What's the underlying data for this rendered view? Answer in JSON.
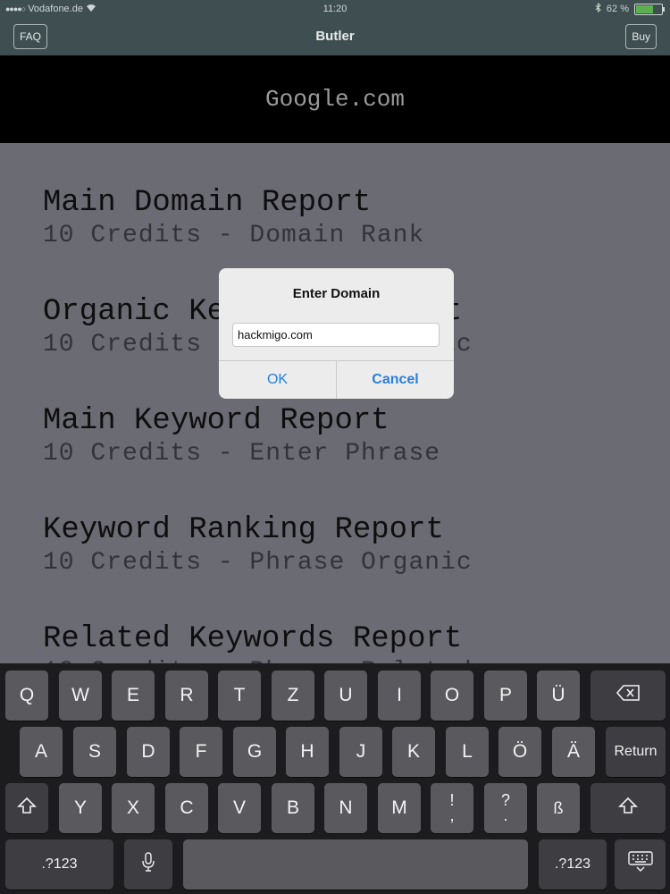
{
  "status_bar": {
    "carrier": "Vodafone.de",
    "time": "11:20",
    "battery_text": "62 %",
    "battery_level": 0.62,
    "battery_color": "#5bb04f"
  },
  "nav": {
    "title": "Butler",
    "left_button": "FAQ",
    "right_button": "Buy"
  },
  "banner": {
    "domain": "Google.com"
  },
  "reports": [
    {
      "name": "Main Domain Report",
      "detail": "10 Credits - Domain Rank"
    },
    {
      "name": "Organic Keywords Report",
      "detail": "10 Credits - Domain Organic"
    },
    {
      "name": "Main Keyword Report",
      "detail": "10 Credits - Enter Phrase"
    },
    {
      "name": "Keyword Ranking Report",
      "detail": "10 Credits - Phrase Organic"
    },
    {
      "name": "Related Keywords Report",
      "detail": "10 Credits - Phrase Related"
    }
  ],
  "alert": {
    "title": "Enter Domain",
    "input_value": "hackmigo.com",
    "ok_label": "OK",
    "cancel_label": "Cancel",
    "accent_color": "#2b7fd6"
  },
  "keyboard": {
    "row1": [
      "Q",
      "W",
      "E",
      "R",
      "T",
      "Z",
      "U",
      "I",
      "O",
      "P",
      "Ü"
    ],
    "row2": [
      "A",
      "S",
      "D",
      "F",
      "G",
      "H",
      "J",
      "K",
      "L",
      "Ö",
      "Ä"
    ],
    "row3": [
      "Y",
      "X",
      "C",
      "V",
      "B",
      "N",
      "M"
    ],
    "exclaim_top": "!",
    "exclaim_bottom": ",",
    "question_top": "?",
    "question_bottom": ".",
    "sharp_s": "ß",
    "return_label": "Return",
    "numbers_label": ".?123",
    "icons": {
      "backspace": "backspace-icon",
      "shift": "shift-icon",
      "mic": "microphone-icon",
      "hide": "keyboard-hide-icon"
    }
  }
}
